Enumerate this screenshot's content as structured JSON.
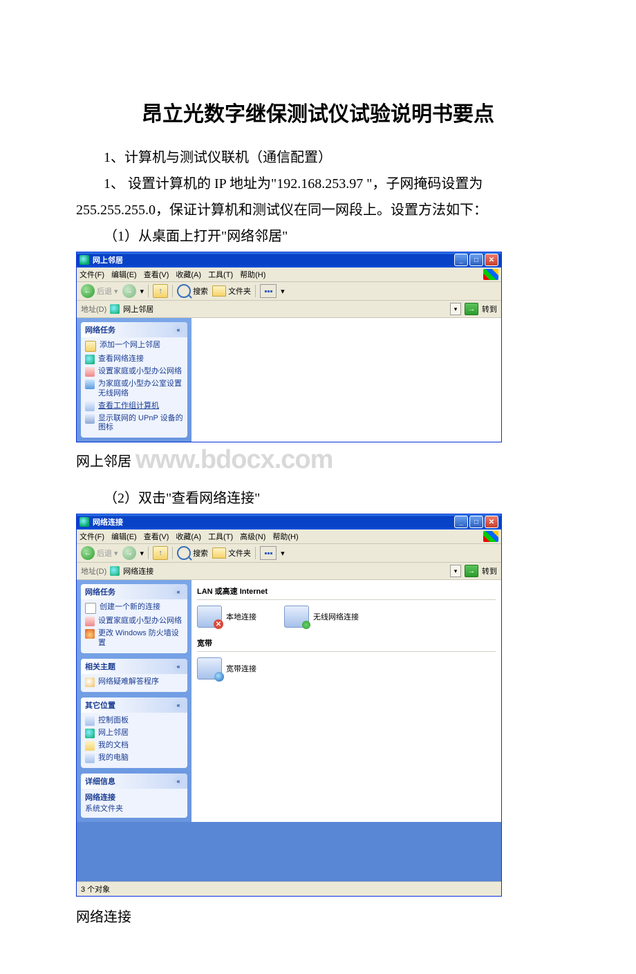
{
  "doc": {
    "title": "昂立光数字继保测试仪试验说明书要点",
    "p1": "1、计算机与测试仪联机（通信配置）",
    "p2a": "1、 设置计算机的 IP 地址为\"192.168.253.97 \"，子网掩码设置为",
    "p2b": "255.255.255.0，保证计算机和测试仪在同一网段上。设置方法如下：",
    "p3": "（1）从桌面上打开\"网络邻居\"",
    "caption1": "网上邻居",
    "watermark": "www.bdocx.com",
    "p4": "（2）双击\"查看网络连接\"",
    "caption2": "网络连接"
  },
  "win1": {
    "title": "网上邻居",
    "menus": [
      "文件(F)",
      "编辑(E)",
      "查看(V)",
      "收藏(A)",
      "工具(T)",
      "帮助(H)"
    ],
    "back": "后退",
    "search": "搜索",
    "folders": "文件夹",
    "addrLabel": "地址(D)",
    "addrText": "网上邻居",
    "go": "转到",
    "panelTitle": "网络任务",
    "tasks": [
      "添加一个网上邻居",
      "查看网络连接",
      "设置家庭或小型办公网络",
      "为家庭或小型办公室设置无线网络",
      "查看工作组计算机",
      "显示联网的 UPnP 设备的图标"
    ]
  },
  "win2": {
    "title": "网络连接",
    "menus": [
      "文件(F)",
      "编辑(E)",
      "查看(V)",
      "收藏(A)",
      "工具(T)",
      "高级(N)",
      "帮助(H)"
    ],
    "back": "后退",
    "search": "搜索",
    "folders": "文件夹",
    "addrLabel": "地址(D)",
    "addrText": "网络连接",
    "go": "转到",
    "panel1Title": "网络任务",
    "panel1Tasks": [
      "创建一个新的连接",
      "设置家庭或小型办公网络",
      "更改 Windows 防火墙设置"
    ],
    "panel2Title": "相关主题",
    "panel2Tasks": [
      "网络疑难解答程序"
    ],
    "panel3Title": "其它位置",
    "panel3Tasks": [
      "控制面板",
      "网上邻居",
      "我的文档",
      "我的电脑"
    ],
    "panel4Title": "详细信息",
    "detailName": "网络连接",
    "detailType": "系统文件夹",
    "grp1": "LAN 或高速 Internet",
    "conn1": "本地连接",
    "conn2": "无线网络连接",
    "grp2": "宽带",
    "conn3": "宽带连接",
    "status": "3 个对象"
  }
}
